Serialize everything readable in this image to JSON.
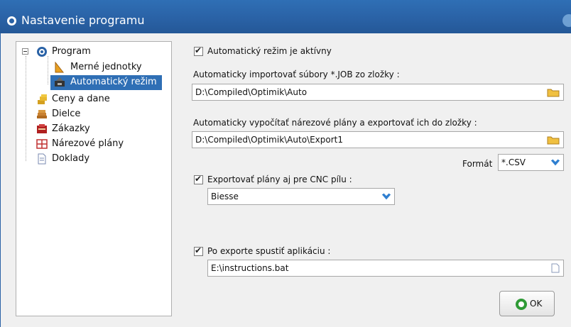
{
  "window": {
    "title": "Nastavenie programu"
  },
  "tree": {
    "items": [
      {
        "label": "Program",
        "icon": "program-icon"
      },
      {
        "label": "Merné jednotky",
        "icon": "ruler-icon"
      },
      {
        "label": "Automatický režim",
        "icon": "auto-mode-icon",
        "selected": true
      },
      {
        "label": "Ceny a dane",
        "icon": "coins-icon"
      },
      {
        "label": "Dielce",
        "icon": "panels-icon"
      },
      {
        "label": "Zákazky",
        "icon": "orders-icon"
      },
      {
        "label": "Nárezové plány",
        "icon": "cutting-plans-icon"
      },
      {
        "label": "Doklady",
        "icon": "documents-icon"
      }
    ]
  },
  "settings": {
    "auto_mode_label": "Automatický režim je aktívny",
    "import_label": "Automaticky importovať súbory *.JOB zo zložky :",
    "import_path": "D:\\Compiled\\Optimik\\Auto",
    "export_label": "Automaticky vypočítať nárezové plány a exportovať ich do zložky :",
    "export_path": "D:\\Compiled\\Optimik\\Auto\\Export1",
    "format_label": "Formát",
    "format_value": "*.CSV",
    "cnc_label": "Exportovať plány aj pre CNC pílu :",
    "cnc_value": "Biesse",
    "after_export_label": "Po exporte spustiť aplikáciu :",
    "after_export_path": "E:\\instructions.bat"
  },
  "buttons": {
    "ok_label": "OK"
  },
  "colors": {
    "titlebar": "#2a62a6",
    "selection": "#2f6fb5",
    "dropdown_arrow": "#2f7fd0",
    "ok_icon": "#2e9a35"
  }
}
